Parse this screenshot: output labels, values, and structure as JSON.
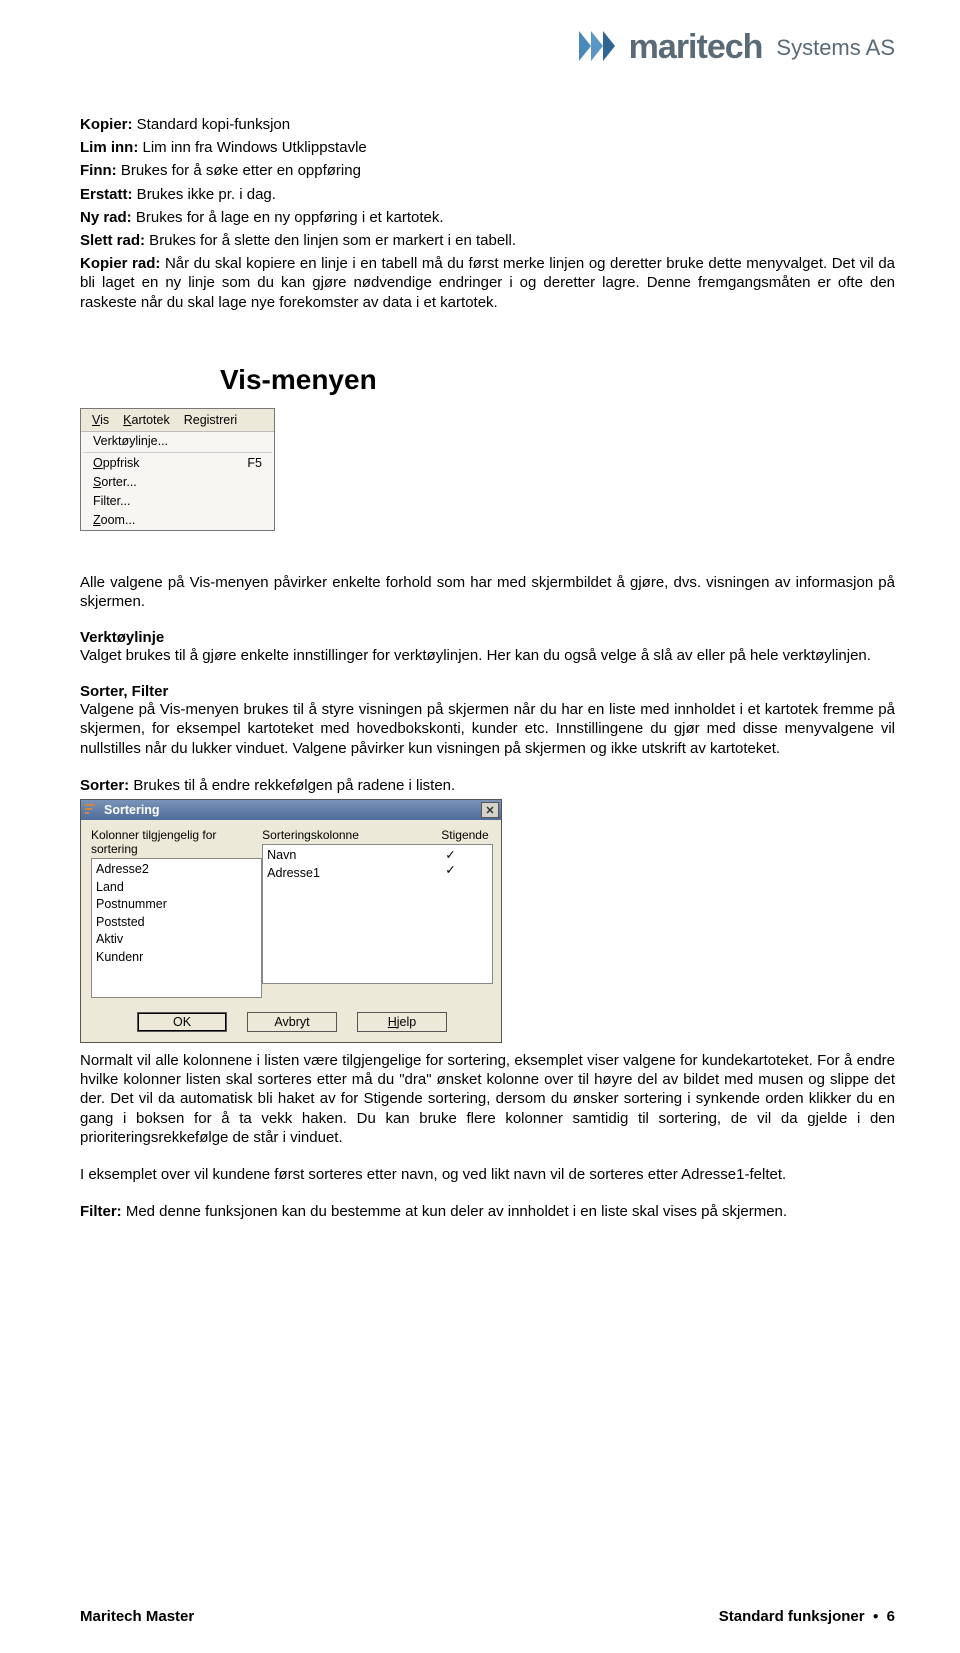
{
  "header": {
    "brand": "maritech",
    "company": "Systems AS"
  },
  "intro": {
    "kopier_b": "Kopier:",
    "kopier_t": " Standard kopi-funksjon",
    "liminn_b": "Lim inn:",
    "liminn_t": " Lim inn fra Windows Utklippstavle",
    "finn_b": "Finn:",
    "finn_t": " Brukes for å søke etter en oppføring",
    "erstatt_b": "Erstatt:",
    "erstatt_t": " Brukes ikke pr. i dag.",
    "nyrad_b": "Ny rad:",
    "nyrad_t": " Brukes for å lage en ny oppføring i et kartotek.",
    "slettrad_b": "Slett rad:",
    "slettrad_t": " Brukes for å slette den linjen som er markert i en tabell.",
    "kopierrad_b": "Kopier rad:",
    "kopierrad_t": " Når du skal kopiere en linje i en tabell må du først merke linjen og deretter bruke dette menyvalget. Det vil da bli laget en ny linje som du kan gjøre nødvendige endringer i og deretter lagre. Denne fremgangsmåten er ofte den raskeste når du skal lage nye forekomster av data i et kartotek."
  },
  "section_title": "Vis-menyen",
  "menu": {
    "bar": [
      "Vis",
      "Kartotek",
      "Registreri"
    ],
    "items": [
      {
        "label": "Verktøylinje...",
        "short": ""
      },
      {
        "label": "Oppfrisk",
        "short": "F5"
      },
      {
        "label": "Sorter...",
        "short": ""
      },
      {
        "label": "Filter...",
        "short": ""
      },
      {
        "label": "Zoom...",
        "short": ""
      }
    ]
  },
  "body": {
    "p1": "Alle valgene på Vis-menyen påvirker enkelte forhold som har med skjermbildet å gjøre, dvs. visningen av informasjon på skjermen.",
    "h1": "Verktøylinje",
    "p2": "Valget brukes til å gjøre enkelte innstillinger for verktøylinjen. Her kan du også velge å slå av eller på hele verktøylinjen.",
    "h2": "Sorter, Filter",
    "p3": "Valgene på Vis-menyen brukes til å styre visningen på skjermen når du har en liste med innholdet i et kartotek fremme på skjermen, for eksempel kartoteket med hovedbokskonti, kunder etc. Innstillingene du gjør med disse menyvalgene vil nullstilles når du lukker vinduet. Valgene påvirker kun visningen på skjermen og ikke utskrift av kartoteket.",
    "sorter_b": "Sorter:",
    "sorter_t": " Brukes til å endre rekkefølgen på radene i listen.",
    "p4": "Normalt vil alle kolonnene i listen være tilgjengelige for sortering, eksemplet viser valgene for kundekartoteket. For å endre hvilke kolonner listen skal sorteres etter må du \"dra\" ønsket kolonne over til høyre del av bildet med musen og slippe det der. Det vil da automatisk bli haket av for Stigende sortering, dersom du ønsker sortering i synkende orden klikker du en gang i boksen for å ta vekk haken. Du kan bruke flere kolonner samtidig til sortering, de vil da gjelde i den prioriteringsrekkefølge de står i vinduet.",
    "p5": "I eksemplet over vil kundene først sorteres etter navn, og ved likt navn vil de sorteres etter Adresse1-feltet.",
    "filter_b": "Filter:",
    "filter_t": " Med denne funksjonen kan du bestemme at kun deler av innholdet i en liste skal vises på skjermen."
  },
  "dialog": {
    "title": "Sortering",
    "col1_label": "Kolonner tilgjengelig for sortering",
    "col2_label": "Sorteringskolonne",
    "col3_label": "Stigende",
    "available": [
      "Adresse2",
      "Land",
      "Postnummer",
      "Poststed",
      "Aktiv",
      "Kundenr"
    ],
    "selected": [
      "Navn",
      "Adresse1"
    ],
    "checks": [
      "✓",
      "✓"
    ],
    "ok": "OK",
    "avbryt": "Avbryt",
    "hjelp": "Hjelp"
  },
  "footer": {
    "left": "Maritech Master",
    "right": "Standard funksjoner",
    "page": "6"
  }
}
